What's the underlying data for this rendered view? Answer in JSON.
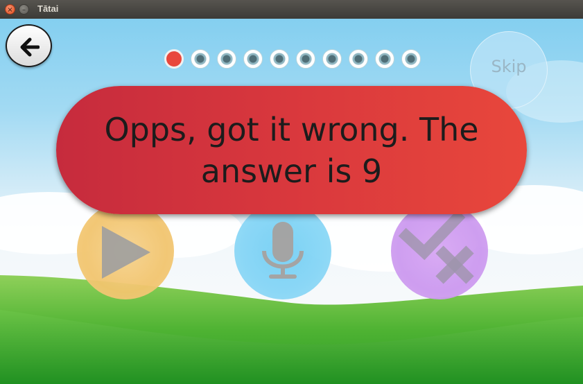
{
  "window": {
    "title": "Tātai",
    "close_glyph": "×",
    "minimize_glyph": "–"
  },
  "back_button": {
    "icon": "arrow-left-icon"
  },
  "progress": {
    "total": 10,
    "completed": 1,
    "colors": {
      "completed": "#e8473c",
      "pending_center": "#4f6e77"
    }
  },
  "skip": {
    "label": "Skip"
  },
  "feedback": {
    "message": "Opps, got it wrong. The answer is 9",
    "color": "#e8473c"
  },
  "actions": {
    "play": {
      "icon": "play-icon",
      "color": "#f2c56e"
    },
    "record": {
      "icon": "microphone-icon",
      "color": "#86d6f6"
    },
    "check": {
      "icon": "check-cross-icon",
      "color": "#cc99f0"
    }
  }
}
